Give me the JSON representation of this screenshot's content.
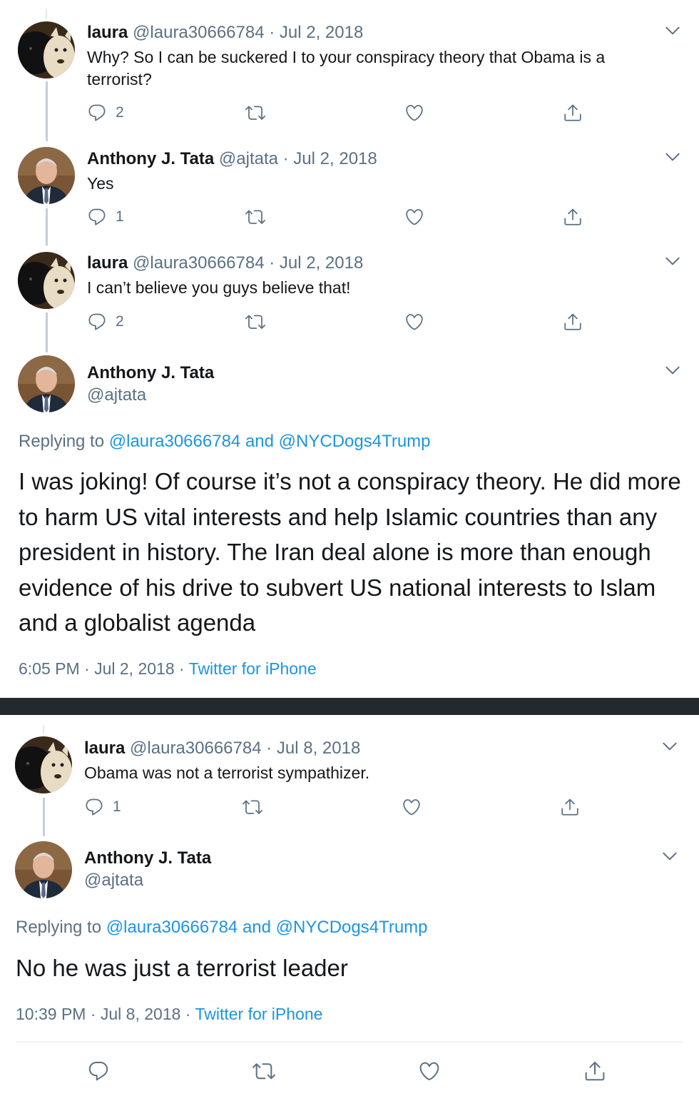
{
  "colors": {
    "link": "#1b95e0",
    "muted": "#5b7083",
    "text": "#14171a",
    "divider": "#24292e"
  },
  "icons": {
    "reply": "reply-icon",
    "retweet": "retweet-icon",
    "like": "heart-icon",
    "share": "share-icon",
    "more": "chevron-down-icon"
  },
  "panel1": {
    "tweets": [
      {
        "name": "laura",
        "handle_date": "@laura30666784 · Jul 2, 2018",
        "text": "Why?  So I can be suckered I to your conspiracy theory that Obama is a terrorist?",
        "reply_count": "2"
      },
      {
        "name": "Anthony J. Tata",
        "handle_date": "@ajtata · Jul 2, 2018",
        "text": "Yes",
        "reply_count": "1"
      },
      {
        "name": "laura",
        "handle_date": "@laura30666784 · Jul 2, 2018",
        "text": "I can’t believe you guys believe that!",
        "reply_count": "2"
      }
    ],
    "main": {
      "name": "Anthony J. Tata",
      "handle": "@ajtata",
      "replying_prefix": "Replying to",
      "replying_user1": "@laura30666784",
      "replying_and": "and",
      "replying_user2": "@NYCDogs4Trump",
      "text": "I was joking! Of course it’s not a conspiracy theory. He did more to harm US vital interests and help Islamic countries than any president in history. The Iran deal alone is more than enough evidence of his drive to subvert US national interests to Islam and a globalist agenda",
      "time_date": "6:05 PM · Jul 2, 2018 ·",
      "source": "Twitter for iPhone"
    }
  },
  "panel2": {
    "tweets": [
      {
        "name": "laura",
        "handle_date": "@laura30666784 · Jul 8, 2018",
        "text": "Obama was not a terrorist sympathizer.",
        "reply_count": "1"
      }
    ],
    "main": {
      "name": "Anthony J. Tata",
      "handle": "@ajtata",
      "replying_prefix": "Replying to",
      "replying_user1": "@laura30666784",
      "replying_and": "and",
      "replying_user2": "@NYCDogs4Trump",
      "text": "No he was just a terrorist leader",
      "time_date": "10:39 PM · Jul 8, 2018 ·",
      "source": "Twitter for iPhone"
    }
  }
}
